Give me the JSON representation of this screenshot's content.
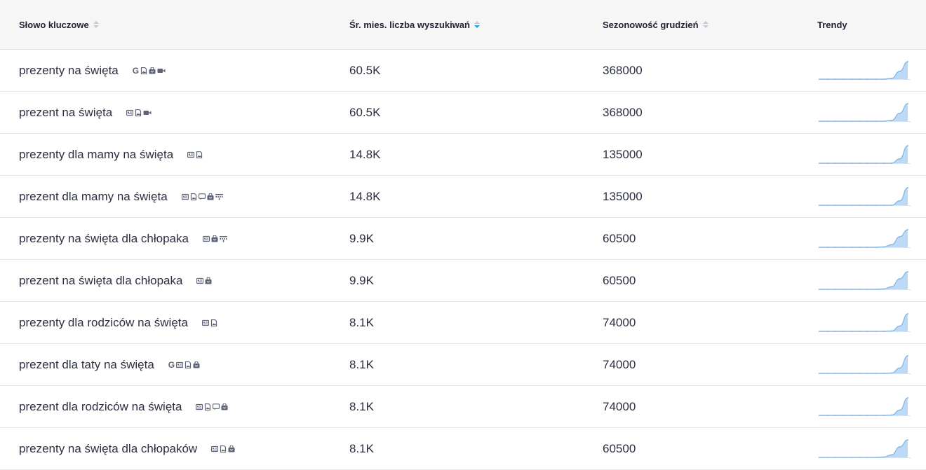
{
  "header": {
    "keyword": "Słowo kluczowe",
    "volume": "Śr. mies. liczba wyszukiwań",
    "seasonality": "Sezonowość grudzień",
    "trends": "Trendy"
  },
  "colors": {
    "header_bg": "#f6f6f7",
    "text": "#2b2f45",
    "sort_active": "#1aa9e6",
    "trend_fill": "#bcd9f5",
    "trend_line": "#7fb4e6",
    "icon": "#5f6377"
  },
  "rows": [
    {
      "keyword": "prezenty na święta",
      "volume": "60.5K",
      "seasonality": "368000",
      "icons": [
        "google-icon",
        "image-icon",
        "shopping-bag-icon",
        "video-icon"
      ],
      "trend": [
        0,
        0,
        0,
        0,
        0,
        0,
        0,
        0,
        0,
        0.05,
        0.45,
        1
      ]
    },
    {
      "keyword": "prezent na święta",
      "volume": "60.5K",
      "seasonality": "368000",
      "icons": [
        "featured-snippet-icon",
        "image-icon",
        "video-icon"
      ],
      "trend": [
        0,
        0,
        0,
        0,
        0,
        0,
        0,
        0,
        0,
        0.05,
        0.45,
        1
      ]
    },
    {
      "keyword": "prezenty dla mamy na święta",
      "volume": "14.8K",
      "seasonality": "135000",
      "icons": [
        "featured-snippet-icon",
        "image-icon"
      ],
      "trend": [
        0,
        0,
        0,
        0,
        0,
        0,
        0,
        0,
        0,
        0,
        0.25,
        1
      ]
    },
    {
      "keyword": "prezent dla mamy na święta",
      "volume": "14.8K",
      "seasonality": "135000",
      "icons": [
        "featured-snippet-icon",
        "image-icon",
        "reviews-icon",
        "shopping-bag-icon",
        "sitelinks-icon"
      ],
      "trend": [
        0,
        0,
        0,
        0,
        0,
        0,
        0,
        0,
        0,
        0,
        0.25,
        1
      ]
    },
    {
      "keyword": "prezenty na święta dla chłopaka",
      "volume": "9.9K",
      "seasonality": "60500",
      "icons": [
        "featured-snippet-icon",
        "shopping-bag-icon",
        "sitelinks-icon"
      ],
      "trend": [
        0,
        0,
        0,
        0,
        0,
        0,
        0,
        0,
        0.02,
        0.15,
        0.6,
        1
      ]
    },
    {
      "keyword": "prezent na święta dla chłopaka",
      "volume": "9.9K",
      "seasonality": "60500",
      "icons": [
        "featured-snippet-icon",
        "shopping-bag-icon"
      ],
      "trend": [
        0,
        0,
        0,
        0,
        0,
        0,
        0,
        0,
        0.02,
        0.15,
        0.6,
        1
      ]
    },
    {
      "keyword": "prezenty dla rodziców na święta",
      "volume": "8.1K",
      "seasonality": "74000",
      "icons": [
        "featured-snippet-icon",
        "image-icon"
      ],
      "trend": [
        0,
        0,
        0,
        0,
        0,
        0,
        0,
        0,
        0,
        0.02,
        0.3,
        1
      ]
    },
    {
      "keyword": "prezent dla taty na święta",
      "volume": "8.1K",
      "seasonality": "74000",
      "icons": [
        "google-icon",
        "featured-snippet-icon",
        "image-icon",
        "shopping-bag-icon"
      ],
      "trend": [
        0,
        0,
        0,
        0,
        0,
        0,
        0,
        0,
        0,
        0.02,
        0.3,
        1
      ]
    },
    {
      "keyword": "prezent dla rodziców na święta",
      "volume": "8.1K",
      "seasonality": "74000",
      "icons": [
        "featured-snippet-icon",
        "image-icon",
        "reviews-icon",
        "shopping-bag-icon"
      ],
      "trend": [
        0,
        0,
        0,
        0,
        0,
        0,
        0,
        0,
        0,
        0.02,
        0.3,
        1
      ]
    },
    {
      "keyword": "prezenty na święta dla chłopaków",
      "volume": "8.1K",
      "seasonality": "60500",
      "icons": [
        "featured-snippet-icon",
        "image-icon",
        "shopping-bag-icon"
      ],
      "trend": [
        0,
        0,
        0,
        0,
        0,
        0,
        0,
        0,
        0.02,
        0.15,
        0.6,
        1
      ]
    }
  ]
}
